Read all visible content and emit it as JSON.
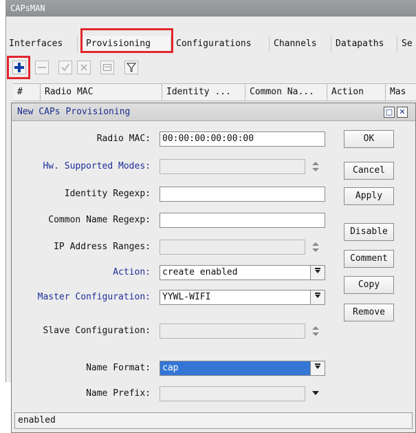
{
  "window": {
    "title": "CAPsMAN"
  },
  "tabs": [
    "Interfaces",
    "Provisioning",
    "Configurations",
    "Channels",
    "Datapaths",
    "Se"
  ],
  "toolbar": {
    "add_icon": "plus-icon",
    "remove_icon": "minus-icon",
    "enable_icon": "check-icon",
    "disable_icon": "x-icon",
    "comment_icon": "note-icon",
    "filter_icon": "filter-icon"
  },
  "table_columns": [
    "#",
    "Radio MAC",
    "Identity ...",
    "Common Na...",
    "Action",
    "Mas"
  ],
  "dialog": {
    "title": "New CAPs Provisioning",
    "fields": {
      "radio_mac": {
        "label": "Radio MAC:",
        "value": "00:00:00:00:00:00"
      },
      "hw_modes": {
        "label": "Hw. Supported Modes:",
        "value": ""
      },
      "identity_regexp": {
        "label": "Identity Regexp:",
        "value": ""
      },
      "common_name_regexp": {
        "label": "Common Name Regexp:",
        "value": ""
      },
      "ip_ranges": {
        "label": "IP Address Ranges:",
        "value": ""
      },
      "action": {
        "label": "Action:",
        "value": "create enabled"
      },
      "master_config": {
        "label": "Master Configuration:",
        "value": "YYWL-WIFI"
      },
      "slave_config": {
        "label": "Slave Configuration:",
        "value": ""
      },
      "name_format": {
        "label": "Name Format:",
        "value": "cap"
      },
      "name_prefix": {
        "label": "Name Prefix:",
        "value": ""
      }
    },
    "buttons": {
      "ok": "OK",
      "cancel": "Cancel",
      "apply": "Apply",
      "disable": "Disable",
      "comment": "Comment",
      "copy": "Copy",
      "remove": "Remove"
    },
    "status": "enabled"
  },
  "colors": {
    "highlight_red": "#e3262e",
    "label_blue": "#1d2f9a",
    "selection_blue": "#3376d6",
    "plus_blue": "#0c3ea6"
  }
}
